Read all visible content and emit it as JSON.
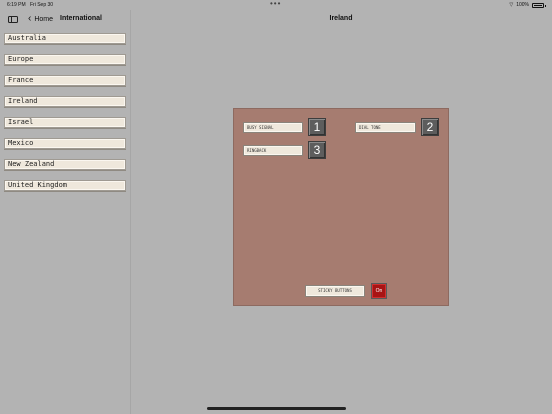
{
  "status_bar": {
    "time": "6:19 PM",
    "date": "Fri Sep 30",
    "dots": "•••",
    "battery_percent": "100%"
  },
  "sidebar": {
    "back_label": "Home",
    "title": "International",
    "items": [
      {
        "label": "Australia"
      },
      {
        "label": "Europe"
      },
      {
        "label": "France"
      },
      {
        "label": "Ireland"
      },
      {
        "label": "Israel"
      },
      {
        "label": "Mexico"
      },
      {
        "label": "New Zealand"
      },
      {
        "label": "United Kingdom"
      }
    ]
  },
  "main": {
    "title": "Ireland",
    "tones": [
      {
        "label": "BUSY SIGNAL",
        "key": "1"
      },
      {
        "label": "DIAL TONE",
        "key": "2"
      },
      {
        "label": "RINGBACK",
        "key": "3"
      }
    ],
    "sticky": {
      "label": "STICKY BUTTONS",
      "state": "On"
    }
  },
  "colors": {
    "background": "#b3b3b3",
    "panel": "#a67c70",
    "button_face": "#efe8dc",
    "key_badge": "#5d5d5d",
    "toggle_on": "#a81414"
  }
}
